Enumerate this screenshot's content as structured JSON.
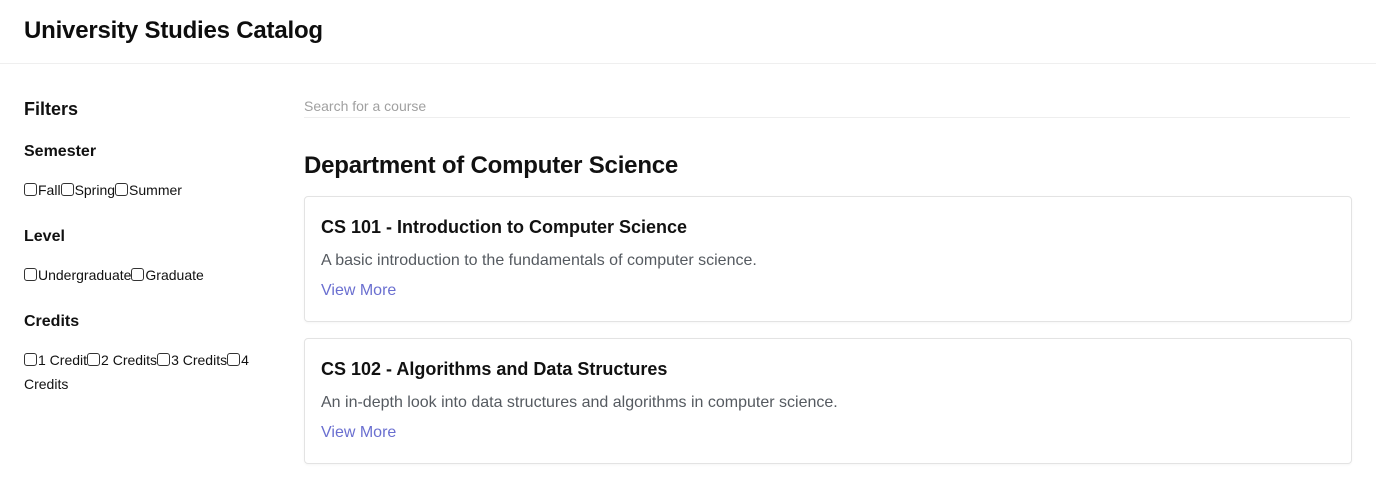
{
  "header": {
    "title": "University Studies Catalog"
  },
  "sidebar": {
    "title": "Filters",
    "groups": [
      {
        "title": "Semester",
        "options": [
          "Fall",
          "Spring",
          "Summer"
        ]
      },
      {
        "title": "Level",
        "options": [
          "Undergraduate",
          "Graduate"
        ]
      },
      {
        "title": "Credits",
        "options": [
          "1 Credit",
          "2 Credits",
          "3 Credits",
          "4 Credits"
        ]
      }
    ]
  },
  "search": {
    "placeholder": "Search for a course",
    "value": ""
  },
  "department": {
    "title": "Department of Computer Science",
    "courses": [
      {
        "title": "CS 101 - Introduction to Computer Science",
        "description": "A basic introduction to the fundamentals of computer science.",
        "link_label": "View More"
      },
      {
        "title": "CS 102 - Algorithms and Data Structures",
        "description": "An in-depth look into data structures and algorithms in computer science.",
        "link_label": "View More"
      }
    ]
  },
  "colors": {
    "link": "#6a6fd0",
    "description": "#555a60",
    "border": "#e3e3e3"
  }
}
